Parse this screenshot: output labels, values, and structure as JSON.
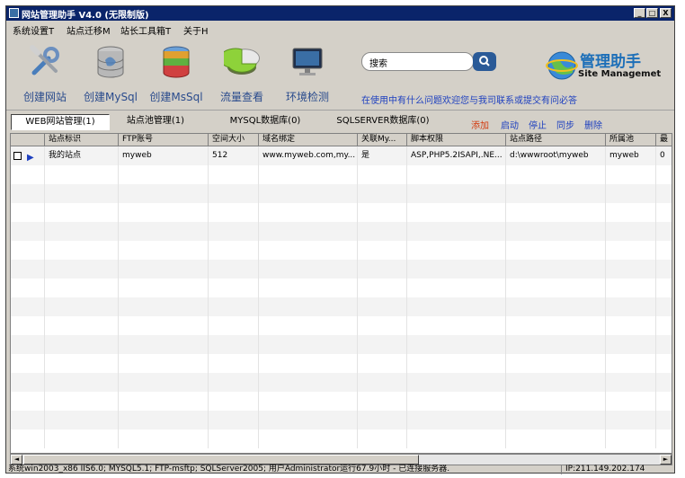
{
  "window": {
    "title": "网站管理助手 V4.0 (无限制版)",
    "min_label": "_",
    "max_label": "□",
    "close_label": "X"
  },
  "menu": {
    "items": [
      {
        "label": "系统设置T"
      },
      {
        "label": "站点迁移M"
      },
      {
        "label": "站长工具箱T"
      },
      {
        "label": "关于H"
      }
    ]
  },
  "toolbar": {
    "buttons": [
      {
        "label": "创建网站",
        "icon": "tools-icon"
      },
      {
        "label": "创建MySql",
        "icon": "mysql-database-icon"
      },
      {
        "label": "创建MsSql",
        "icon": "mssql-database-icon"
      },
      {
        "label": "流量查看",
        "icon": "pie-chart-icon"
      },
      {
        "label": "环境检测",
        "icon": "monitor-icon"
      }
    ],
    "search": {
      "value": "搜索",
      "button_icon": "search-icon"
    },
    "help_text": "在使用中有什么问题欢迎您与我司联系或提交有问必答",
    "logo": {
      "title": "管理助手",
      "subtitle": "Site Managemet"
    }
  },
  "tabs": [
    {
      "label": "WEB网站管理(1)",
      "active": true
    },
    {
      "label": "站点池管理(1)",
      "active": false
    },
    {
      "label": "MYSQL数据库(0)",
      "active": false
    },
    {
      "label": "SQLSERVER数据库(0)",
      "active": false
    }
  ],
  "actions": [
    {
      "label": "添加",
      "color": "#d33a0e"
    },
    {
      "label": "启动",
      "color": "#1d3fbf"
    },
    {
      "label": "停止",
      "color": "#1d3fbf"
    },
    {
      "label": "同步",
      "color": "#1d3fbf"
    },
    {
      "label": "删除",
      "color": "#1d3fbf"
    }
  ],
  "grid": {
    "columns": [
      "站点标识",
      "FTP账号",
      "空间大小",
      "域名绑定",
      "关联My...",
      "脚本权限",
      "站点路径",
      "所属池",
      "最"
    ],
    "rows": [
      {
        "site_id": "我的站点",
        "ftp": "myweb",
        "space": "512",
        "domains": "www.myweb.com,my...",
        "linked": "是",
        "script": "ASP,PHP5.2ISAPI,.NE...",
        "path": "d:\\wwwroot\\myweb",
        "pool": "myweb",
        "last": "0"
      }
    ]
  },
  "scrollbar": {
    "left_arrow": "◄",
    "right_arrow": "►"
  },
  "status": {
    "left": "系统win2003_x86 IIS6.0; MYSQL5.1; FTP-msftp; SQLServer2005; 用户Administrator运行67.9小时 - 已连接服务器.",
    "right": "IP:211.149.202.174"
  },
  "colors": {
    "title_bar": "#0a246a",
    "accent": "#2a5a97",
    "link": "#1d3fbf",
    "add_link": "#d33a0e"
  }
}
